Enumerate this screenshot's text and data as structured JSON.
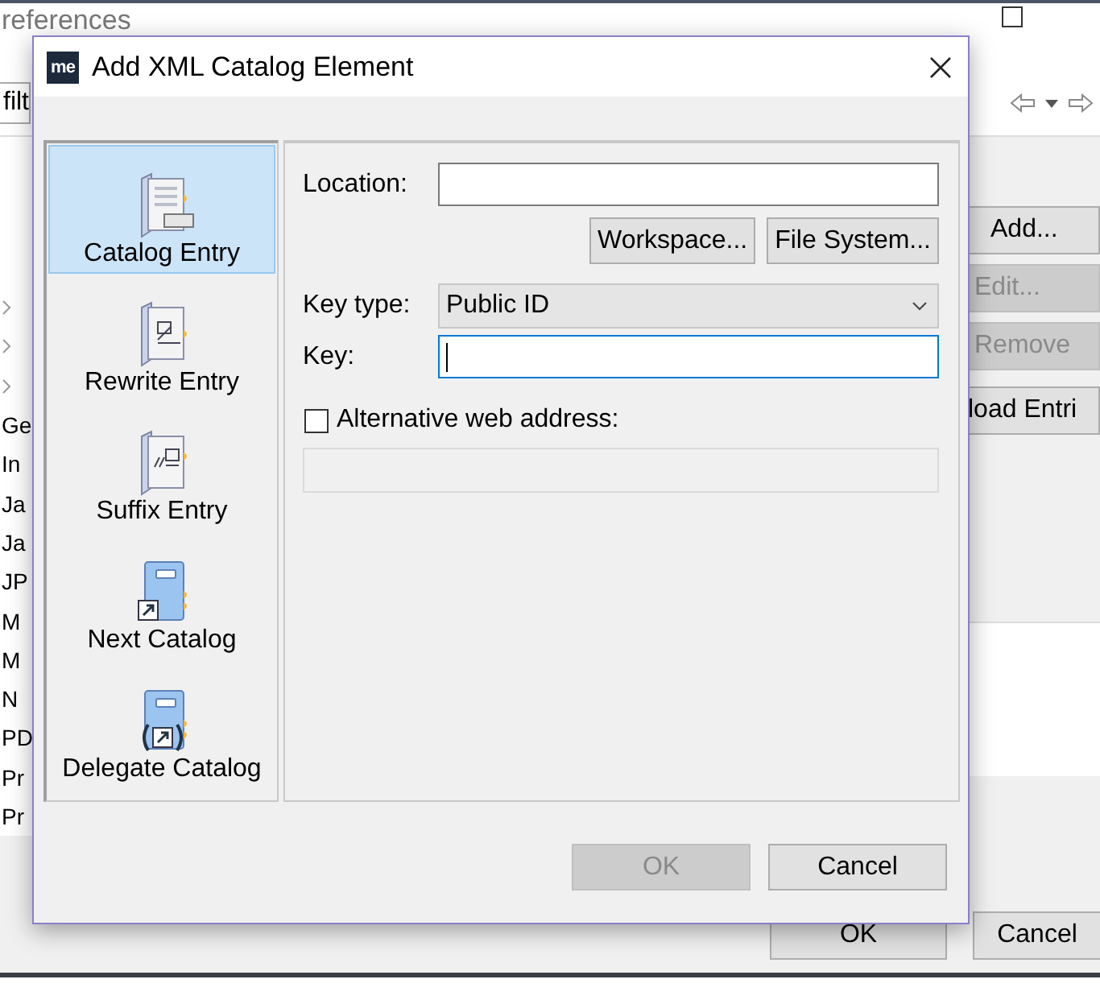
{
  "background_window": {
    "title": "references",
    "filter_text": "filt",
    "tree_items": [
      {
        "label": "Ge"
      },
      {
        "label": "In"
      },
      {
        "label": "Ja"
      },
      {
        "label": "Ja"
      },
      {
        "label": "JP"
      },
      {
        "label": "M"
      },
      {
        "label": "M"
      },
      {
        "label": "N"
      },
      {
        "label": "PD"
      },
      {
        "label": "Pr"
      },
      {
        "label": "Pr"
      }
    ],
    "side_buttons": [
      {
        "label": "Add...",
        "disabled": false
      },
      {
        "label": "Edit...",
        "disabled": true
      },
      {
        "label": "Remove",
        "disabled": true
      }
    ],
    "reload_button": {
      "label": "load Entri"
    },
    "footer_buttons": [
      {
        "label": "OK"
      },
      {
        "label": "Cancel"
      }
    ]
  },
  "dialog": {
    "logo_text": "me",
    "title": "Add XML Catalog Element",
    "entry_types": [
      {
        "label": "Catalog Entry",
        "kind": "entry",
        "selected": true
      },
      {
        "label": "Rewrite Entry",
        "kind": "rewrite",
        "selected": false
      },
      {
        "label": "Suffix Entry",
        "kind": "suffix",
        "selected": false
      },
      {
        "label": "Next Catalog",
        "kind": "next",
        "selected": false
      },
      {
        "label": "Delegate Catalog",
        "kind": "delegate",
        "selected": false
      }
    ],
    "location": {
      "label": "Location:"
    },
    "browse_buttons": [
      {
        "label": "Workspace..."
      },
      {
        "label": "File System..."
      }
    ],
    "key_type": {
      "label": "Key type:",
      "value": "Public ID"
    },
    "key": {
      "label": "Key:",
      "focused": true
    },
    "alternative": {
      "label": "Alternative web address:",
      "checked": false,
      "field_disabled": true
    },
    "buttons": [
      {
        "label": "OK",
        "disabled": true
      },
      {
        "label": "Cancel",
        "disabled": false
      }
    ]
  }
}
